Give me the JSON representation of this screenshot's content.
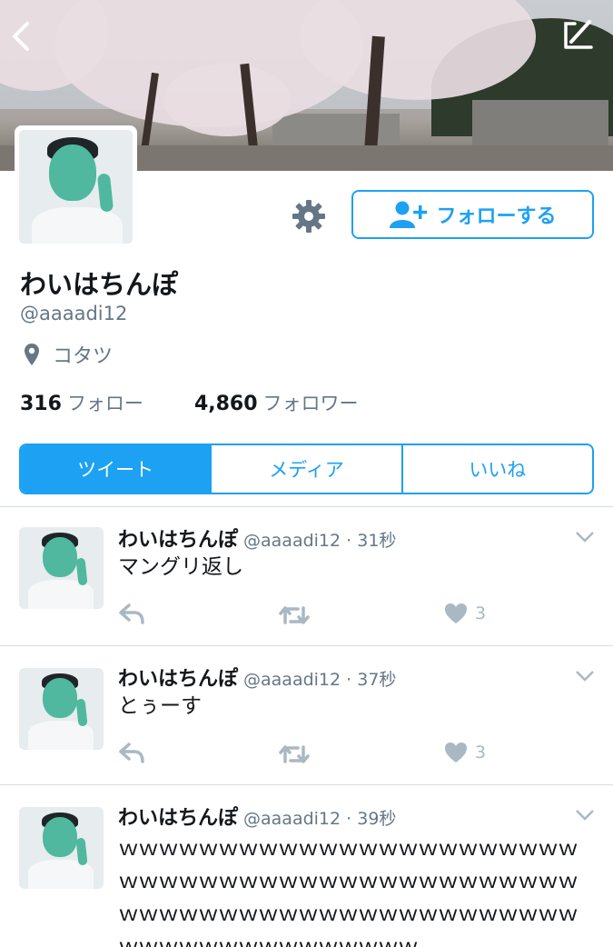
{
  "profile": {
    "display_name": "わいはちんぽ",
    "handle": "@aaaadi12",
    "location": "コタツ",
    "following_count": "316",
    "following_label": "フォロー",
    "followers_count": "4,860",
    "followers_label": "フォロワー",
    "follow_button_label": "フォローする"
  },
  "tabs": [
    {
      "label": "ツイート",
      "active": true
    },
    {
      "label": "メディア",
      "active": false
    },
    {
      "label": "いいね",
      "active": false
    }
  ],
  "tweets": [
    {
      "name": "わいはちんぽ",
      "handle": "@aaaadi12",
      "time": "31秒",
      "text": "マングリ返し",
      "likes": "3"
    },
    {
      "name": "わいはちんぽ",
      "handle": "@aaaadi12",
      "time": "37秒",
      "text": "とぅーす",
      "likes": "3"
    },
    {
      "name": "わいはちんぽ",
      "handle": "@aaaadi12",
      "time": "39秒",
      "text": "ｗｗｗｗｗｗｗｗｗｗｗｗｗｗｗｗｗｗｗｗｗｗｗｗｗｗｗｗｗｗｗｗｗｗｗｗｗｗｗｗｗｗｗｗｗｗｗｗｗｗｗｗｗｗｗｗｗｗｗｗｗｗｗｗｗｗｗｗｗｗｗｗｗｗｗｗｗｗｗｗｗｗｗｗ",
      "likes": ""
    }
  ],
  "icons": {
    "back": "chevron-left-icon",
    "compose": "compose-icon",
    "settings": "gear-icon",
    "follow": "add-user-icon",
    "location": "location-pin-icon",
    "reply": "reply-icon",
    "retweet": "retweet-icon",
    "like": "heart-icon",
    "caret": "chevron-down-icon"
  },
  "colors": {
    "accent": "#1da1f2",
    "secondary_text": "#657786",
    "action_icon": "#aab8c2"
  }
}
